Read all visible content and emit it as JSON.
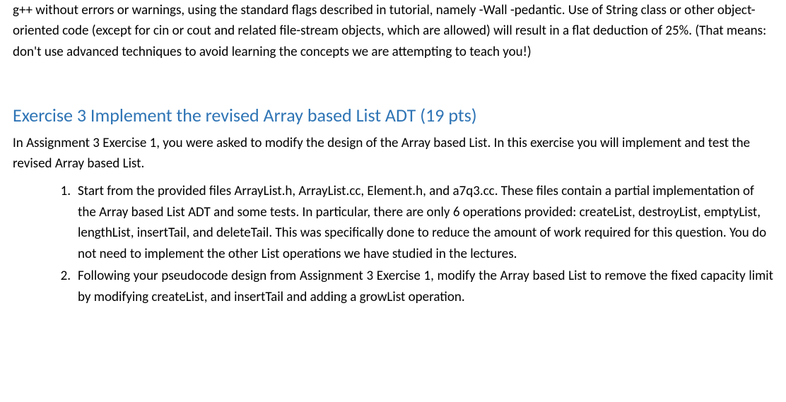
{
  "intro_paragraph": "g++ without errors or warnings, using the standard flags described in tutorial, namely -Wall -pedantic. Use of String class or other object-oriented code (except for cin or cout and related file-stream objects, which are allowed) will result in a flat deduction of 25%. (That means: don't use advanced techniques to avoid learning the concepts we are attempting to teach you!)",
  "exercise3": {
    "heading": "Exercise 3 Implement the revised Array based List ADT (19 pts)",
    "intro": "In Assignment 3 Exercise 1, you were asked to modify the design of the Array based List. In this exercise you will implement and test the revised Array based List.",
    "items": [
      "Start from the provided files ArrayList.h, ArrayList.cc, Element.h, and a7q3.cc. These files contain a partial implementation of the Array based List ADT and some tests. In particular, there are only 6 operations provided: createList, destroyList, emptyList, lengthList, insertTail, and deleteTail. This was specifically done to reduce the amount of work required for this question. You do not need to implement the other List operations we have studied in the lectures.",
      "Following your pseudocode design from Assignment 3 Exercise 1, modify the Array based List to remove the fixed capacity limit by modifying createList, and insertTail and adding a growList operation."
    ]
  }
}
